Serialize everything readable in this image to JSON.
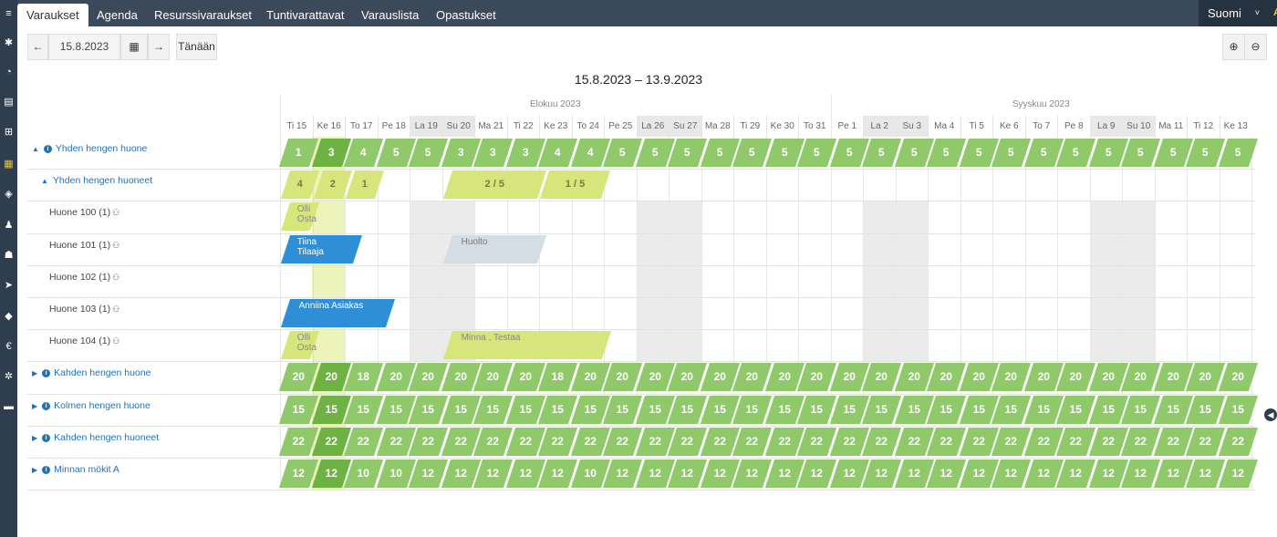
{
  "sidebar": {
    "icons": [
      "menu-icon",
      "settings-icon",
      "dashboard-icon",
      "reports-icon",
      "cart-icon",
      "calendar-icon",
      "discount-icon",
      "person-icon",
      "group-icon",
      "send-icon",
      "tag-icon",
      "euro-icon",
      "gear-icon",
      "truck-icon"
    ]
  },
  "nav": {
    "tabs": [
      "Varaukset",
      "Agenda",
      "Resurssivaraukset",
      "Tuntivarattavat",
      "Varauslista",
      "Opastukset"
    ],
    "language": "Suomi",
    "font_size_toggle": "AA"
  },
  "toolbar": {
    "prev": "←",
    "date": "15.8.2023",
    "calendar": "▦",
    "next": "→",
    "today": "Tänään",
    "zoom_in": "⊕",
    "zoom_out": "⊖"
  },
  "range_title": "15.8.2023 – 13.9.2023",
  "months": [
    "Elokuu 2023",
    "Syyskuu 2023"
  ],
  "days": [
    "Ti 15",
    "Ke 16",
    "To 17",
    "Pe 18",
    "La 19",
    "Su 20",
    "Ma 21",
    "Ti 22",
    "Ke 23",
    "To 24",
    "Pe 25",
    "La 26",
    "Su 27",
    "Ma 28",
    "Ti 29",
    "Ke 30",
    "To 31",
    "Pe 1",
    "La 2",
    "Su 3",
    "Ma 4",
    "Ti 5",
    "Ke 6",
    "To 7",
    "Pe 8",
    "La 9",
    "Su 10",
    "Ma 11",
    "Ti 12",
    "Ke 13"
  ],
  "weekend_indices": [
    4,
    5,
    11,
    12,
    18,
    19,
    25,
    26
  ],
  "rows": [
    {
      "label": "Yhden hengen huone",
      "type": "group",
      "expanded": true,
      "avail": [
        1,
        3,
        4,
        5,
        5,
        3,
        3,
        3,
        4,
        4,
        5,
        5,
        5,
        5,
        5,
        5,
        5,
        5,
        5,
        5,
        5,
        5,
        5,
        5,
        5,
        5,
        5,
        5,
        5,
        5
      ]
    },
    {
      "label": "Yhden hengen huoneet",
      "type": "subgroup",
      "expanded": true,
      "sub": [
        {
          "text": "4",
          "from": 0,
          "to": 0
        },
        {
          "text": "2",
          "from": 1,
          "to": 1
        },
        {
          "text": "1",
          "from": 2,
          "to": 2
        },
        {
          "text": "2 / 5",
          "from": 5,
          "to": 7
        },
        {
          "text": "1 / 5",
          "from": 8,
          "to": 9
        }
      ]
    },
    {
      "label": "Huone 100 (1)",
      "type": "room",
      "bookings": [
        {
          "text": "Olli\nOsta",
          "from": 0,
          "to": 0,
          "kind": "sub"
        }
      ]
    },
    {
      "label": "Huone 101 (1)",
      "type": "room",
      "bookings": [
        {
          "text": "Tiina\nTilaaja",
          "from": 0,
          "to": 1,
          "kind": "blue"
        },
        {
          "text": "Huolto",
          "from": 5,
          "to": 7,
          "kind": "grey"
        }
      ]
    },
    {
      "label": "Huone 102 (1)",
      "type": "room",
      "bookings": []
    },
    {
      "label": "Huone 103 (1)",
      "type": "room",
      "bookings": [
        {
          "text": "Anniina Asiakas",
          "from": 0,
          "to": 2,
          "kind": "blue"
        }
      ]
    },
    {
      "label": "Huone 104 (1)",
      "type": "room",
      "bookings": [
        {
          "text": "Olli\nOsta",
          "from": 0,
          "to": 0,
          "kind": "sub"
        },
        {
          "text": "Minna , Testaa",
          "from": 5,
          "to": 9,
          "kind": "sub"
        }
      ]
    },
    {
      "label": "Kahden hengen huone",
      "type": "group",
      "expanded": false,
      "avail": [
        20,
        20,
        18,
        20,
        20,
        20,
        20,
        20,
        18,
        20,
        20,
        20,
        20,
        20,
        20,
        20,
        20,
        20,
        20,
        20,
        20,
        20,
        20,
        20,
        20,
        20,
        20,
        20,
        20,
        20
      ]
    },
    {
      "label": "Kolmen hengen huone",
      "type": "group",
      "expanded": false,
      "avail": [
        15,
        15,
        15,
        15,
        15,
        15,
        15,
        15,
        15,
        15,
        15,
        15,
        15,
        15,
        15,
        15,
        15,
        15,
        15,
        15,
        15,
        15,
        15,
        15,
        15,
        15,
        15,
        15,
        15,
        15
      ]
    },
    {
      "label": "Kahden hengen huoneet",
      "type": "group",
      "expanded": false,
      "avail": [
        22,
        22,
        22,
        22,
        22,
        22,
        22,
        22,
        22,
        22,
        22,
        22,
        22,
        22,
        22,
        22,
        22,
        22,
        22,
        22,
        22,
        22,
        22,
        22,
        22,
        22,
        22,
        22,
        22,
        22
      ]
    },
    {
      "label": "Minnan mökit A",
      "type": "group",
      "expanded": false,
      "avail": [
        12,
        12,
        10,
        10,
        12,
        12,
        12,
        12,
        12,
        10,
        12,
        12,
        12,
        12,
        12,
        12,
        12,
        12,
        12,
        12,
        12,
        12,
        12,
        12,
        12,
        12,
        12,
        12,
        12,
        12
      ]
    }
  ],
  "colors": {
    "available": "#8fc96a",
    "available_today": "#6fb244",
    "partial": "#d6e67a",
    "booking_blue": "#2e8fd6",
    "booking_grey": "#d4dde3"
  }
}
